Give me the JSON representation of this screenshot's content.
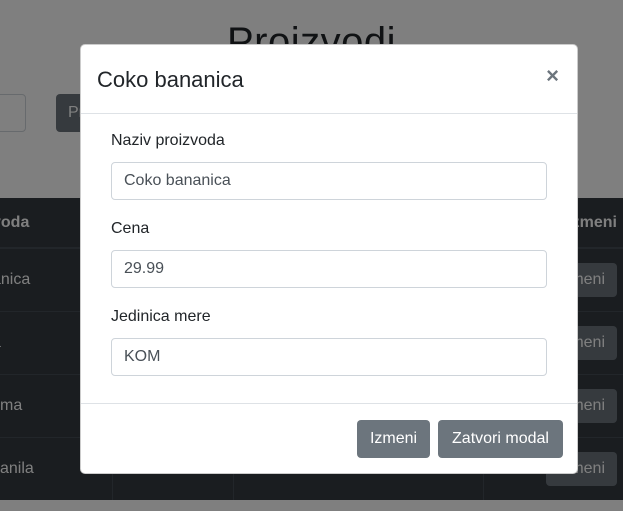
{
  "background": {
    "page_title": "Proizvodi",
    "button_label": "Pr",
    "table": {
      "headers": [
        "voda",
        "",
        "",
        "zmeni"
      ],
      "rows": [
        {
          "name": "anica",
          "action": "Izmeni"
        },
        {
          "name": "a",
          "action": "Izmeni"
        },
        {
          "name": "zma",
          "action": "Izmeni"
        },
        {
          "name": "vanila",
          "action": "Izmeni"
        }
      ]
    }
  },
  "modal": {
    "title": "Coko bananica",
    "close_symbol": "×",
    "fields": {
      "name": {
        "label": "Naziv proizvoda",
        "value": "Coko bananica"
      },
      "price": {
        "label": "Cena",
        "value": "29.99"
      },
      "unit": {
        "label": "Jedinica mere",
        "value": "KOM"
      }
    },
    "buttons": {
      "edit": "Izmeni",
      "close": "Zatvori modal"
    }
  },
  "colors": {
    "backdrop": "rgba(0,0,0,0.5)",
    "button_secondary": "#6c757d",
    "table_dark": "#343a40"
  }
}
